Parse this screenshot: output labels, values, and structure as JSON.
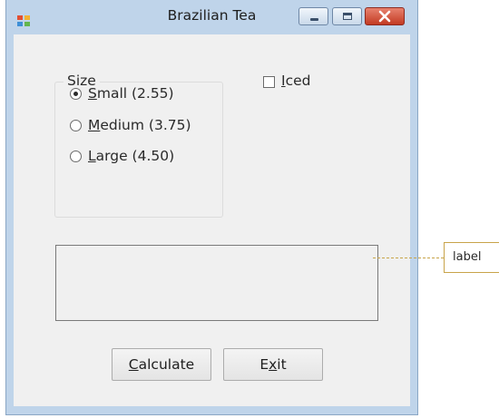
{
  "window": {
    "title": "Brazilian Tea",
    "controls": {
      "minimize": "minimize-icon",
      "maximize": "maximize-icon",
      "close": "close-icon"
    }
  },
  "form": {
    "size_group": {
      "label": "Size",
      "options": [
        {
          "pre": "",
          "mnemonic": "S",
          "post": "mall (2.55)",
          "checked": true
        },
        {
          "pre": "",
          "mnemonic": "M",
          "post": "edium (3.75)",
          "checked": false
        },
        {
          "pre": "",
          "mnemonic": "L",
          "post": "arge (4.50)",
          "checked": false
        }
      ]
    },
    "iced": {
      "pre": "",
      "mnemonic": "I",
      "post": "ced",
      "checked": false
    },
    "output_label_text": "",
    "buttons": {
      "calculate": {
        "pre": "",
        "mnemonic": "C",
        "post": "alculate"
      },
      "exit": {
        "pre": "E",
        "mnemonic": "x",
        "post": "it"
      }
    }
  },
  "annotation": {
    "callout": "label"
  },
  "colors": {
    "close_button": "#c23a22",
    "client_bg": "#f0f0f0",
    "callout": "#c8a44a"
  }
}
